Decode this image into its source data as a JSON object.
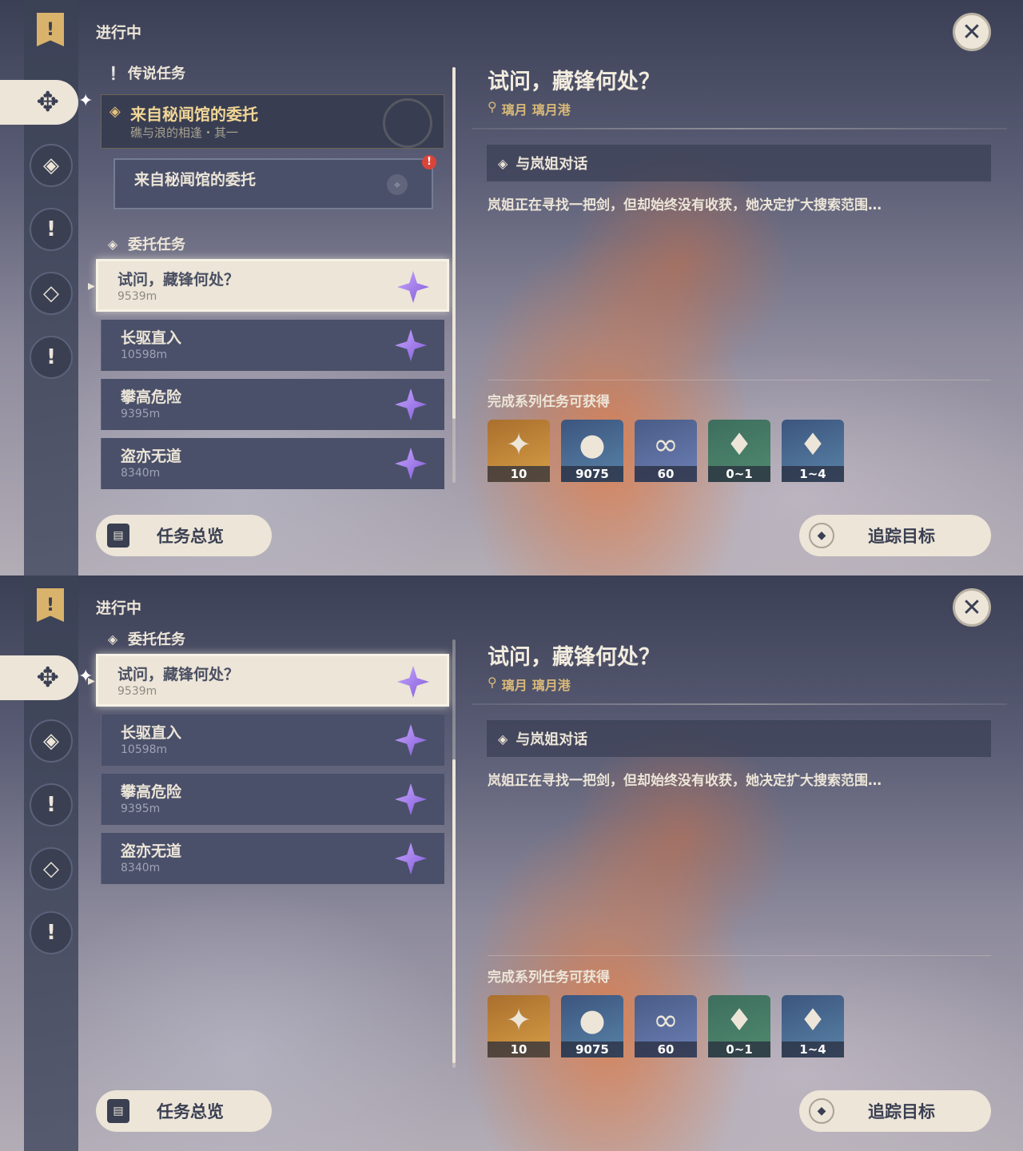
{
  "status_title": "进行中",
  "categories": {
    "legend": "传说任务",
    "commission": "委托任务"
  },
  "legend_quest": {
    "title": "来自秘闻馆的委托",
    "subtitle": "礁与浪的相逢・其一"
  },
  "legend_subquest": {
    "title": "来自秘闻馆的委托"
  },
  "quests": [
    {
      "name": "试问，藏锋何处？",
      "distance": "9539m",
      "selected": true
    },
    {
      "name": "长驱直入",
      "distance": "10598m",
      "selected": false
    },
    {
      "name": "攀高危险",
      "distance": "9395m",
      "selected": false
    },
    {
      "name": "盗亦无道",
      "distance": "8340m",
      "selected": false
    }
  ],
  "detail": {
    "title": "试问，藏锋何处？",
    "location": [
      "璃月",
      "璃月港"
    ],
    "objective": "与岚姐对话",
    "description": "岚姐正在寻找一把剑，但却始终没有收获，她决定扩大搜索范围…",
    "reward_title": "完成系列任务可获得",
    "rewards": [
      {
        "icon": "primogem-icon",
        "count": "10"
      },
      {
        "icon": "mora-icon",
        "count": "9075"
      },
      {
        "icon": "adventure-exp-icon",
        "count": "60"
      },
      {
        "icon": "crystal-icon",
        "count": "0~1"
      },
      {
        "icon": "crystal-cluster-icon",
        "count": "1~4"
      }
    ]
  },
  "buttons": {
    "overview": "任务总览",
    "track": "追踪目标"
  }
}
